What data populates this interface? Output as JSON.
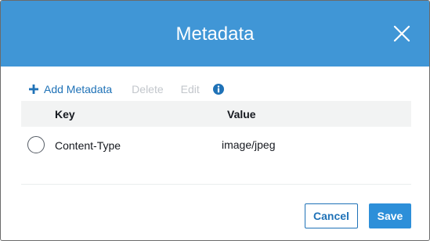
{
  "dialog": {
    "title": "Metadata",
    "close_icon": "close-icon"
  },
  "toolbar": {
    "add_label": "Add Metadata",
    "add_icon": "plus-icon",
    "delete_label": "Delete",
    "edit_label": "Edit",
    "info_icon": "info-icon"
  },
  "table": {
    "columns": [
      "Key",
      "Value"
    ],
    "rows": [
      {
        "key": "Content-Type",
        "value": "image/jpeg",
        "selected": false
      }
    ]
  },
  "footer": {
    "cancel_label": "Cancel",
    "save_label": "Save"
  },
  "colors": {
    "header_bg": "#4096d6",
    "link_blue": "#1f72b7",
    "disabled_text": "#c3c7cc",
    "primary_button": "#2d8fd9"
  }
}
